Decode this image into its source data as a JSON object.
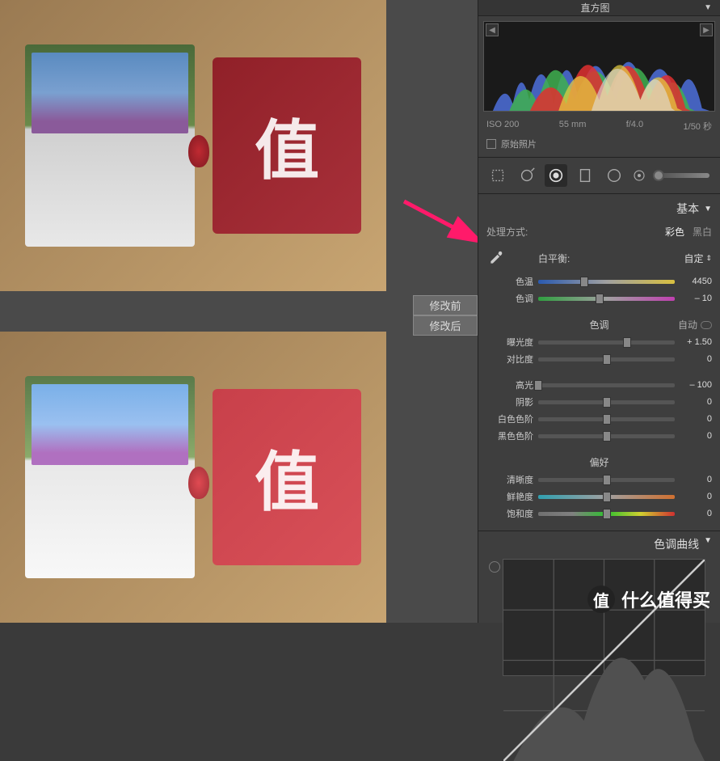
{
  "labels": {
    "before": "修改前",
    "after": "修改后"
  },
  "histogram": {
    "title": "直方图",
    "meta": {
      "iso": "ISO 200",
      "focal": "55 mm",
      "aperture": "f/4.0",
      "shutter": "1/50 秒"
    },
    "original_photo": "原始照片"
  },
  "basic": {
    "title": "基本",
    "treatment": {
      "label": "处理方式:",
      "color": "彩色",
      "bw": "黑白"
    },
    "wb": {
      "label": "白平衡:",
      "preset": "自定"
    },
    "temp": {
      "label": "色温",
      "value": "4450",
      "pos": 34
    },
    "tint": {
      "label": "色调",
      "value": "– 10",
      "pos": 45
    },
    "tone_header": "色调",
    "auto": "自动",
    "exposure": {
      "label": "曝光度",
      "value": "+ 1.50",
      "pos": 65
    },
    "contrast": {
      "label": "对比度",
      "value": "0",
      "pos": 50
    },
    "highlights": {
      "label": "高光",
      "value": "– 100",
      "pos": 0
    },
    "shadows": {
      "label": "阴影",
      "value": "0",
      "pos": 50
    },
    "whites": {
      "label": "白色色阶",
      "value": "0",
      "pos": 50
    },
    "blacks": {
      "label": "黑色色阶",
      "value": "0",
      "pos": 50
    },
    "presence_header": "偏好",
    "clarity": {
      "label": "清晰度",
      "value": "0",
      "pos": 50
    },
    "vibrance": {
      "label": "鲜艳度",
      "value": "0",
      "pos": 50
    },
    "saturation": {
      "label": "饱和度",
      "value": "0",
      "pos": 50
    }
  },
  "tonecurve": {
    "title": "色调曲线"
  },
  "watermark": "什么值得买",
  "watermark_badge": "值"
}
